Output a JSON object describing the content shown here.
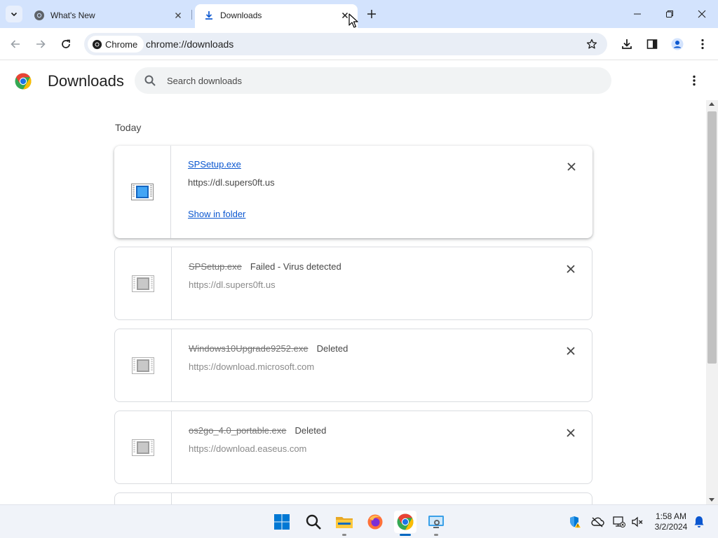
{
  "tabs": [
    {
      "title": "What's New",
      "icon": "chrome-icon",
      "active": false
    },
    {
      "title": "Downloads",
      "icon": "download-icon",
      "active": true
    }
  ],
  "toolbar": {
    "chip_label": "Chrome",
    "url": "chrome://downloads"
  },
  "page": {
    "title": "Downloads",
    "search_placeholder": "Search downloads",
    "section_label": "Today"
  },
  "downloads": [
    {
      "filename": "SPSetup.exe",
      "status": "",
      "source": "https://dl.supers0ft.us",
      "action": "Show in folder",
      "state": "complete"
    },
    {
      "filename": "SPSetup.exe",
      "status": "Failed - Virus detected",
      "source": "https://dl.supers0ft.us",
      "action": "",
      "state": "failed"
    },
    {
      "filename": "Windows10Upgrade9252.exe",
      "status": "Deleted",
      "source": "https://download.microsoft.com",
      "action": "",
      "state": "deleted"
    },
    {
      "filename": "os2go_4.0_portable.exe",
      "status": "Deleted",
      "source": "https://download.easeus.com",
      "action": "",
      "state": "deleted"
    }
  ],
  "taskbar": {
    "apps": [
      "windows-start",
      "search",
      "file-explorer",
      "firefox",
      "chrome",
      "remote-desktop"
    ],
    "time": "1:58 AM",
    "date": "3/2/2024"
  },
  "colors": {
    "tabstrip": "#d3e3fd",
    "accent_link": "#0b57d0",
    "taskbar_active": "#0067c0"
  }
}
